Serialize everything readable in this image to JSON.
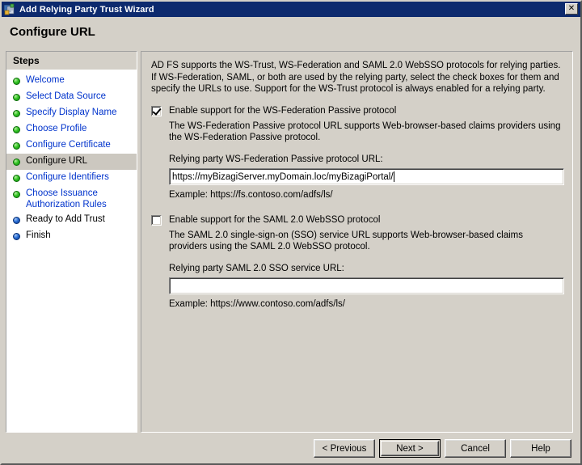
{
  "window": {
    "title": "Add Relying Party Trust Wizard",
    "icon": "wizard-window-icon",
    "close_label": "✕"
  },
  "page": {
    "title": "Configure URL"
  },
  "sidebar": {
    "header": "Steps",
    "items": [
      {
        "label": "Welcome",
        "state": "done"
      },
      {
        "label": "Select Data Source",
        "state": "done"
      },
      {
        "label": "Specify Display Name",
        "state": "done"
      },
      {
        "label": "Choose Profile",
        "state": "done"
      },
      {
        "label": "Configure Certificate",
        "state": "done"
      },
      {
        "label": "Configure URL",
        "state": "current"
      },
      {
        "label": "Configure Identifiers",
        "state": "done"
      },
      {
        "label": "Choose Issuance Authorization Rules",
        "state": "done"
      },
      {
        "label": "Ready to Add Trust",
        "state": "pending"
      },
      {
        "label": "Finish",
        "state": "pending"
      }
    ]
  },
  "main": {
    "intro": "AD FS supports the WS-Trust, WS-Federation and SAML 2.0 WebSSO protocols for relying parties.  If WS-Federation, SAML, or both are used by the relying party, select the check boxes for them and specify the URLs to use.  Support for the WS-Trust protocol is always enabled for a relying party.",
    "wsfed": {
      "checkbox_label": "Enable support for the WS-Federation Passive protocol",
      "checked": true,
      "description": "The WS-Federation Passive protocol URL supports Web-browser-based claims providers using the WS-Federation Passive protocol.",
      "field_label": "Relying party WS-Federation Passive protocol URL:",
      "value": "https://myBizagiServer.myDomain.loc/myBizagiPortal/",
      "placeholder": "",
      "example": "Example: https://fs.contoso.com/adfs/ls/"
    },
    "saml": {
      "checkbox_label": "Enable support for the SAML 2.0 WebSSO protocol",
      "checked": false,
      "description": "The SAML 2.0 single-sign-on (SSO) service URL supports Web-browser-based claims providers using the SAML 2.0 WebSSO protocol.",
      "field_label": "Relying party SAML 2.0 SSO service URL:",
      "value": "",
      "placeholder": "",
      "example": "Example: https://www.contoso.com/adfs/ls/"
    }
  },
  "buttons": {
    "previous": "< Previous",
    "next": "Next >",
    "cancel": "Cancel",
    "help": "Help"
  },
  "colors": {
    "titlebar": "#0d2a6e",
    "face": "#d4d0c8",
    "link": "#0033cc",
    "step_done": "#35c425",
    "step_pending": "#2a6fd6",
    "selection": "#ccc8c0"
  }
}
